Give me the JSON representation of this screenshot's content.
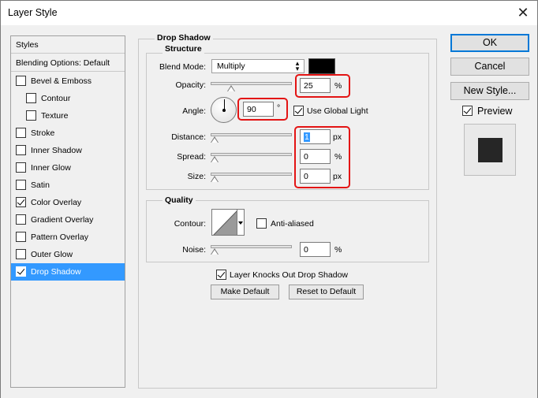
{
  "window": {
    "title": "Layer Style",
    "close_glyph": "✕"
  },
  "style_list": {
    "header_styles": "Styles",
    "header_blending": "Blending Options: Default",
    "items": [
      {
        "label": "Bevel & Emboss",
        "checked": false,
        "indent": 0
      },
      {
        "label": "Contour",
        "checked": false,
        "indent": 1
      },
      {
        "label": "Texture",
        "checked": false,
        "indent": 1
      },
      {
        "label": "Stroke",
        "checked": false,
        "indent": 0
      },
      {
        "label": "Inner Shadow",
        "checked": false,
        "indent": 0
      },
      {
        "label": "Inner Glow",
        "checked": false,
        "indent": 0
      },
      {
        "label": "Satin",
        "checked": false,
        "indent": 0
      },
      {
        "label": "Color Overlay",
        "checked": true,
        "indent": 0
      },
      {
        "label": "Gradient Overlay",
        "checked": false,
        "indent": 0
      },
      {
        "label": "Pattern Overlay",
        "checked": false,
        "indent": 0
      },
      {
        "label": "Outer Glow",
        "checked": false,
        "indent": 0
      },
      {
        "label": "Drop Shadow",
        "checked": true,
        "indent": 0,
        "selected": true
      }
    ]
  },
  "drop_shadow": {
    "title": "Drop Shadow",
    "structure": {
      "title": "Structure",
      "blend_mode_label": "Blend Mode:",
      "blend_mode_value": "Multiply",
      "blend_color": "#000000",
      "opacity_label": "Opacity:",
      "opacity_value": "25",
      "opacity_unit": "%",
      "opacity_slider_fraction": 0.25,
      "angle_label": "Angle:",
      "angle_value": "90",
      "angle_unit": "°",
      "use_global_light_label": "Use Global Light",
      "use_global_light": true,
      "distance_label": "Distance:",
      "distance_value": "1",
      "distance_unit": "px",
      "spread_label": "Spread:",
      "spread_value": "0",
      "spread_unit": "%",
      "size_label": "Size:",
      "size_value": "0",
      "size_unit": "px"
    },
    "quality": {
      "title": "Quality",
      "contour_label": "Contour:",
      "anti_aliased_label": "Anti-aliased",
      "anti_aliased": false,
      "noise_label": "Noise:",
      "noise_value": "0",
      "noise_unit": "%"
    },
    "knocks_out_label": "Layer Knocks Out Drop Shadow",
    "knocks_out": true,
    "make_default_label": "Make Default",
    "reset_default_label": "Reset to Default"
  },
  "buttons": {
    "ok": "OK",
    "cancel": "Cancel",
    "new_style": "New Style...",
    "preview_label": "Preview",
    "preview_checked": true
  },
  "colors": {
    "selection": "#3399ff",
    "highlight_box": "#e31414",
    "preview_square": "#262626"
  }
}
